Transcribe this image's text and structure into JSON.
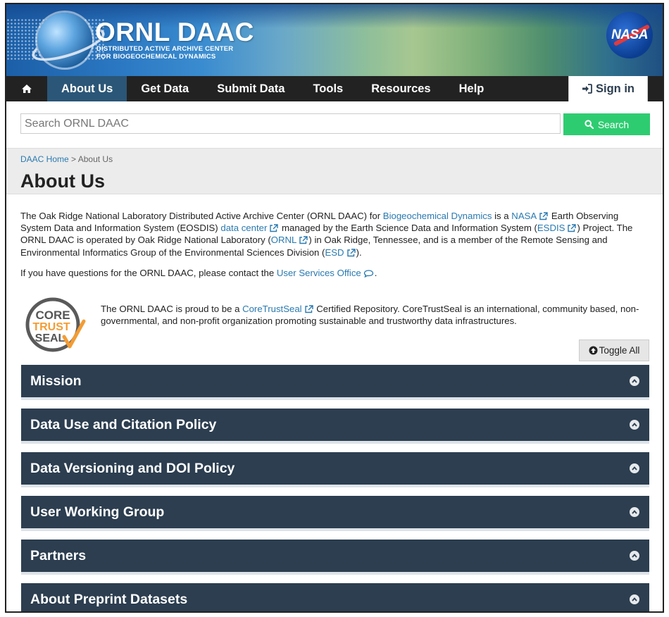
{
  "header": {
    "logo_name": "ORNL DAAC",
    "logo_sub_1": "DISTRIBUTED ACTIVE ARCHIVE CENTER",
    "logo_sub_2": "FOR BIOGEOCHEMICAL DYNAMICS",
    "nasa_label": "NASA"
  },
  "nav": {
    "items": [
      "About Us",
      "Get Data",
      "Submit Data",
      "Tools",
      "Resources",
      "Help"
    ],
    "active": "About Us",
    "signin": "Sign in"
  },
  "search": {
    "placeholder": "Search ORNL DAAC",
    "button": "Search"
  },
  "breadcrumb": {
    "home": "DAAC Home",
    "separator": ">",
    "current": "About Us"
  },
  "page_title": "About Us",
  "intro": {
    "t1": "The Oak Ridge National Laboratory Distributed Active Archive Center (ORNL DAAC) for ",
    "l1": "Biogeochemical Dynamics",
    "t2": " is a ",
    "l2": "NASA",
    "t3": " Earth Observing System Data and Information System (EOSDIS) ",
    "l3": "data center",
    "t4": " managed by the Earth Science Data and Information System (",
    "l4": "ESDIS",
    "t5": ") Project. The ORNL DAAC is operated by Oak Ridge National Laboratory (",
    "l5": "ORNL",
    "t6": ") in Oak Ridge, Tennessee, and is a member of the Remote Sensing and Environmental Informatics Group of the Environmental Sciences Division (",
    "l6": "ESD",
    "t7": ")."
  },
  "contact": {
    "text": "If you have questions for the ORNL DAAC, please contact the ",
    "link": "User Services Office",
    "end": "."
  },
  "coretrustseal": {
    "logo_lines": [
      "CORE",
      "TRUST",
      "SEAL"
    ],
    "t1": "The ORNL DAAC is proud to be a ",
    "link": "CoreTrustSeal",
    "t2": " Certified Repository. CoreTrustSeal is an international, community based, non-governmental, and non-profit organization promoting sustainable and trustworthy data infrastructures."
  },
  "toggle_all": "Toggle All",
  "accordions": [
    "Mission",
    "Data Use and Citation Policy",
    "Data Versioning and DOI Policy",
    "User Working Group",
    "Partners",
    "About Preprint Datasets"
  ],
  "colors": {
    "nav_bg": "#222222",
    "nav_active": "#2b5677",
    "accordion_bg": "#2c3e50",
    "search_button": "#2ecc71",
    "link": "#2a7ab0"
  }
}
